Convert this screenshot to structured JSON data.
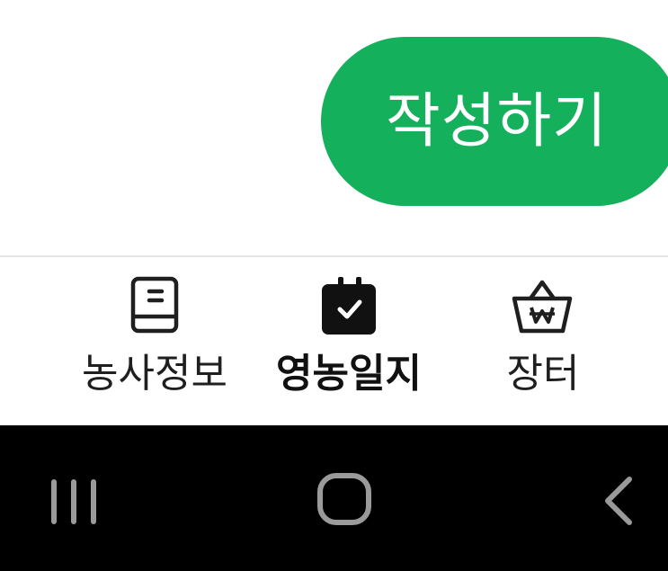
{
  "main": {
    "write_button_label": "작성하기"
  },
  "bottom_nav": {
    "items": [
      {
        "label": "농사정보",
        "icon": "book-icon",
        "active": false
      },
      {
        "label": "영농일지",
        "icon": "calendar-check-icon",
        "active": true
      },
      {
        "label": "장터",
        "icon": "won-basket-icon",
        "active": false
      }
    ]
  },
  "system_nav": {
    "buttons": [
      "recent-apps-icon",
      "home-icon",
      "back-icon"
    ]
  },
  "colors": {
    "accent": "#14b05b",
    "system_bar": "#000000",
    "system_icon": "#9a9a9a"
  }
}
